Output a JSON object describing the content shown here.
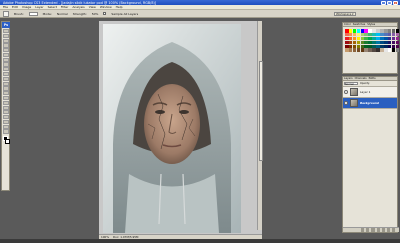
{
  "window": {
    "title": "Adobe Photoshop CS3 Extended - [Jadajin sibik lukator pod @ 100% (Background, RGB/8)]"
  },
  "menu": [
    "File",
    "Edit",
    "Image",
    "Layer",
    "Select",
    "Filter",
    "Analysis",
    "View",
    "Window",
    "Help"
  ],
  "options_bar": {
    "brush_label": "Brush:",
    "mode_label": "Mode:",
    "mode_value": "Normal",
    "strength_label": "Strength:",
    "strength_value": "50%",
    "sample_label": "Sample All Layers",
    "workspace_label": "Workspace ▾"
  },
  "toolbox": {
    "logo": "Ps",
    "tools": [
      "move-tool",
      "marquee-tool",
      "lasso-tool",
      "quick-select-tool",
      "crop-tool",
      "slice-tool",
      "healing-tool",
      "brush-tool",
      "clone-stamp-tool",
      "history-brush-tool",
      "eraser-tool",
      "gradient-tool",
      "blur-tool",
      "dodge-tool",
      "pen-tool",
      "type-tool",
      "path-select-tool",
      "shape-tool",
      "notes-tool",
      "eyedropper-tool",
      "hand-tool",
      "zoom-tool"
    ]
  },
  "status_bar": {
    "zoom": "100%",
    "doc_info": "Doc: 1.07M/5.95M"
  },
  "swatches_panel": {
    "tabs": [
      "Color",
      "Swatches",
      "Styles"
    ],
    "colors": [
      "#ff0000",
      "#ffff00",
      "#00ff00",
      "#00ffff",
      "#0000ff",
      "#ff00ff",
      "#ffffff",
      "#e6e6e6",
      "#cccccc",
      "#b3b3b3",
      "#999999",
      "#808080",
      "#666666",
      "#000000",
      "#f26c4f",
      "#f68e55",
      "#fbaf5c",
      "#fff467",
      "#acd372",
      "#7cc576",
      "#3bb878",
      "#1abbb4",
      "#00bff3",
      "#438ccb",
      "#5574b9",
      "#605ca8",
      "#855fa8",
      "#a763a8",
      "#ed1c24",
      "#f26522",
      "#f7941d",
      "#fff200",
      "#8dc63f",
      "#39b54a",
      "#00a651",
      "#00a99d",
      "#00aeef",
      "#0072bc",
      "#0054a6",
      "#2e3192",
      "#662d91",
      "#92278f",
      "#9e0b0f",
      "#a0410d",
      "#a36209",
      "#aba000",
      "#598527",
      "#1a7b30",
      "#007236",
      "#00746b",
      "#0076a3",
      "#004a80",
      "#003471",
      "#1b1464",
      "#440e62",
      "#630460",
      "#790000",
      "#7b2e00",
      "#7d4900",
      "#827b00",
      "#406618",
      "#005e20",
      "#005826",
      "#005952",
      "#005b7f",
      "#003663",
      "#002157",
      "#0d004c",
      "#32004b",
      "#4b0049",
      "#c69c6d",
      "#a67c52",
      "#8c6239",
      "#754c24",
      "#603913",
      "#998675",
      "#736357",
      "#534741",
      "#362f2d",
      "#c7b299",
      "#e6e6e6",
      "#ffffff",
      "#000000",
      "#808080"
    ]
  },
  "layers_panel": {
    "tabs": [
      "Layers",
      "Channels",
      "Paths"
    ],
    "blend_mode": "Normal",
    "opacity_label": "Opacity:",
    "layers": [
      {
        "name": "Layer 1",
        "active": false
      },
      {
        "name": "Background",
        "active": true
      }
    ]
  }
}
